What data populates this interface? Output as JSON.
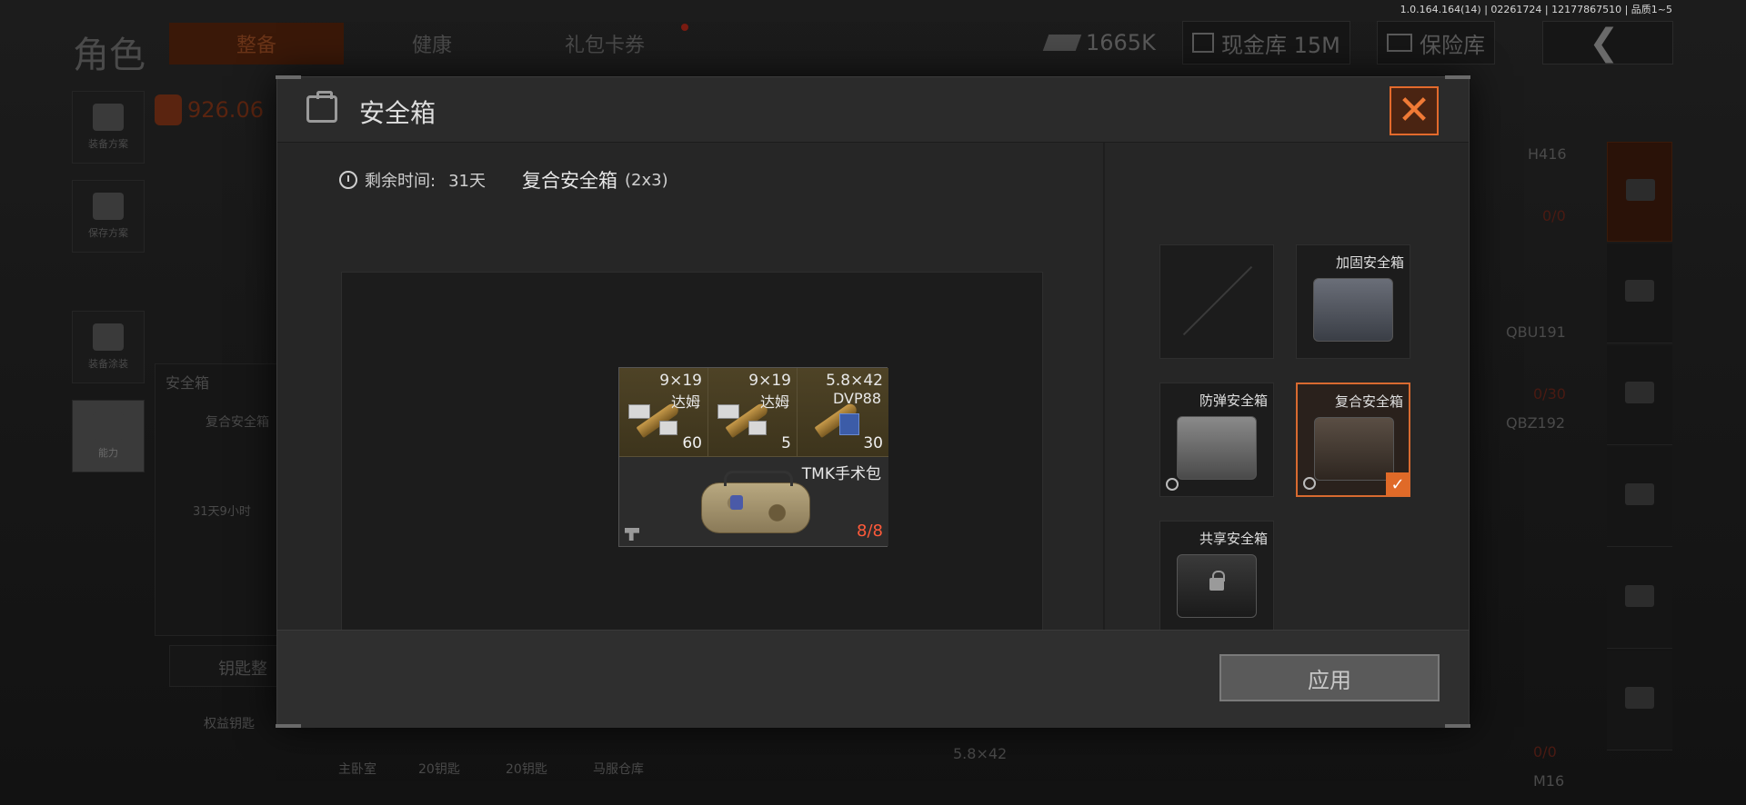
{
  "version_info": "1.0.164.164(14) | 02261724 | 12177867510 | 品质1~5",
  "topbar": {
    "title": "角色",
    "tabs": [
      {
        "label": "整备",
        "active": true
      },
      {
        "label": "健康",
        "active": false
      },
      {
        "label": "礼包卡券",
        "active": false
      }
    ],
    "currency": "1665K",
    "cash_vault": "现金库 15M",
    "insurance_vault": "保险库"
  },
  "sidebar": {
    "money": "926.06",
    "buttons": [
      {
        "label": "装备方案"
      },
      {
        "label": "保存方案"
      },
      {
        "label": "装备涂装"
      },
      {
        "label": "能力"
      }
    ]
  },
  "background": {
    "secure_box_label": "安全箱",
    "secure_box_item": "复合安全箱",
    "secure_box_time": "31天9小时",
    "key_button": "钥匙整",
    "benefit_key": "权益钥匙",
    "key_tabs": [
      "主卧室",
      "20钥匙",
      "20钥匙",
      "马服仓库"
    ],
    "weapons": [
      "H416",
      "QBU191",
      "QBZ192",
      "5.8×42",
      "M16"
    ],
    "ammo_counts": [
      "0/0",
      "0/30",
      "0/0"
    ]
  },
  "modal": {
    "title": "安全箱",
    "remaining_label": "剩余时间:",
    "remaining_value": "31天",
    "box_name": "复合安全箱",
    "box_size": "(2x3)",
    "items": {
      "ammo": [
        {
          "caliber": "9×19",
          "brand": "达姆",
          "count": "60",
          "variant": "std"
        },
        {
          "caliber": "9×19",
          "brand": "达姆",
          "count": "5",
          "variant": "std"
        },
        {
          "caliber": "5.8×42",
          "brand": "DVP88",
          "count": "30",
          "variant": "blue"
        }
      ],
      "medkit": {
        "name": "TMK手术包",
        "durability": "8/8"
      }
    },
    "cases": [
      {
        "label": "",
        "type": "empty",
        "selected": false
      },
      {
        "label": "加固安全箱",
        "type": "reinforced",
        "selected": false
      },
      {
        "label": "防弹安全箱",
        "type": "bullet",
        "selected": false,
        "timed": true
      },
      {
        "label": "复合安全箱",
        "type": "composite",
        "selected": true,
        "timed": true
      },
      {
        "label": "共享安全箱",
        "type": "shared",
        "selected": false,
        "locked": true
      }
    ],
    "apply_label": "应用",
    "close_symbol": "✕",
    "check_symbol": "✓"
  },
  "colors": {
    "accent": "#e06a28",
    "durability": "#ff5a3a"
  }
}
